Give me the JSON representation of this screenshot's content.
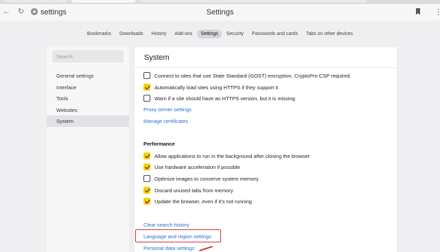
{
  "window": {
    "address_text": "settings",
    "page_title": "Settings"
  },
  "nav_tabs": [
    {
      "label": "Bookmarks",
      "active": false
    },
    {
      "label": "Downloads",
      "active": false
    },
    {
      "label": "History",
      "active": false
    },
    {
      "label": "Add-ons",
      "active": false
    },
    {
      "label": "Settings",
      "active": true
    },
    {
      "label": "Security",
      "active": false
    },
    {
      "label": "Passwords and cards",
      "active": false
    },
    {
      "label": "Tabs on other devices",
      "active": false
    }
  ],
  "sidebar": {
    "search_placeholder": "Search",
    "items": [
      {
        "label": "General settings",
        "active": false
      },
      {
        "label": "Interface",
        "active": false
      },
      {
        "label": "Tools",
        "active": false
      },
      {
        "label": "Websites",
        "active": false
      },
      {
        "label": "System",
        "active": true
      }
    ]
  },
  "main": {
    "title": "System",
    "network_options": [
      {
        "label": "Connect to sites that use State Standard (GOST) encryption. CryptoPro CSP required.",
        "checked": false
      },
      {
        "label": "Automatically load sites using HTTPS if they support it",
        "checked": true
      },
      {
        "label": "Warn if a site should have an HTTPS version, but it is missing",
        "checked": false
      }
    ],
    "proxy_link": "Proxy server settings",
    "certificates_link": "Manage certificates",
    "performance_heading": "Performance",
    "performance_options": [
      {
        "label": "Allow applications to run in the background after closing the browser",
        "checked": true
      },
      {
        "label": "Use hardware acceleration if possible",
        "checked": true
      },
      {
        "label": "Optimize images to conserve system memory",
        "checked": false
      },
      {
        "label": "Discard unused tabs from memory",
        "checked": true
      },
      {
        "label": "Update the browser, even if it's not running",
        "checked": true
      }
    ],
    "clear_history_link": "Clear search history",
    "language_link": "Language and region settings",
    "personal_data_link": "Personal data settings"
  },
  "colors": {
    "accent_checkbox": "#ffcc00",
    "link": "#1e6fd6",
    "highlight": "#d0302e"
  }
}
